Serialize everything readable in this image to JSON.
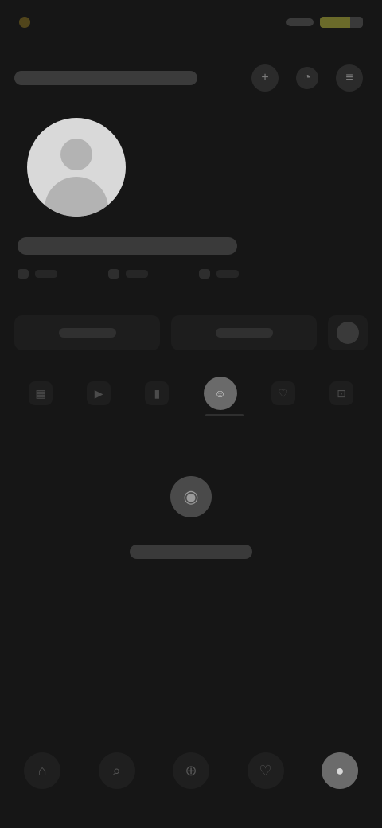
{
  "status_bar": {
    "time": "",
    "icons": [
      "signal-icon",
      "wifi-icon",
      "battery-icon"
    ]
  },
  "header": {
    "username": "",
    "actions": [
      {
        "icon": "add-icon"
      },
      {
        "icon": "notifications-icon"
      },
      {
        "icon": "menu-icon"
      }
    ]
  },
  "profile": {
    "avatar_icon": "person-silhouette-icon",
    "display_name": "",
    "stats": [
      {
        "value": "",
        "label": ""
      },
      {
        "value": "",
        "label": ""
      },
      {
        "value": "",
        "label": ""
      }
    ]
  },
  "actions": {
    "primary_label": "",
    "secondary_label": "",
    "more_icon": "person-add-icon"
  },
  "tabs": [
    {
      "icon": "grid-icon",
      "active": false
    },
    {
      "icon": "reels-icon",
      "active": false
    },
    {
      "icon": "bookmark-icon",
      "active": false
    },
    {
      "icon": "profile-tag-icon",
      "active": true
    },
    {
      "icon": "heart-icon",
      "active": false
    },
    {
      "icon": "lock-icon",
      "active": false
    }
  ],
  "empty_state": {
    "icon": "camera-icon",
    "message": ""
  },
  "bottom_nav": [
    {
      "icon": "home-icon",
      "active": false
    },
    {
      "icon": "search-icon",
      "active": false
    },
    {
      "icon": "create-icon",
      "active": false
    },
    {
      "icon": "activity-icon",
      "active": false
    },
    {
      "icon": "profile-icon",
      "active": true
    }
  ],
  "colors": {
    "background": "#161616",
    "surface": "#1d1d1d",
    "avatar": "#d9d9d9",
    "active_tab": "#6a6a6a"
  }
}
